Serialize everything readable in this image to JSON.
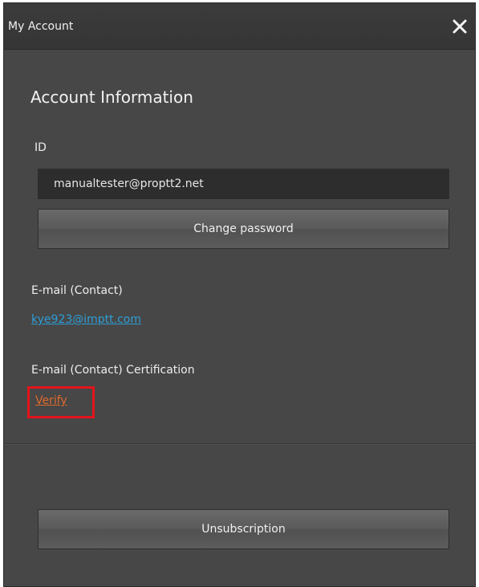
{
  "window": {
    "title": "My Account",
    "close_icon": "close-icon"
  },
  "account": {
    "section_title": "Account Information",
    "id_label": "ID",
    "id_value": "manualtester@proptt2.net",
    "change_password_label": "Change password",
    "email_label": "E-mail (Contact)",
    "email_value": "kye923@imptt.com",
    "certification_label": "E-mail (Contact) Certification",
    "verify_label": "Verify",
    "unsubscription_label": "Unsubscription"
  },
  "colors": {
    "dialog_bg": "#474747",
    "email_link": "#2e9ed6",
    "verify_link": "#e06a2a",
    "highlight_box": "#e3141b"
  }
}
